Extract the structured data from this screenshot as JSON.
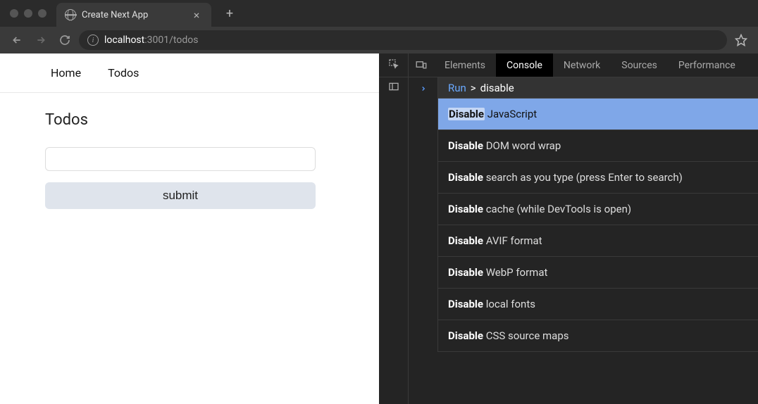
{
  "browser": {
    "tab_title": "Create Next App",
    "url_host": "localhost",
    "url_port": ":3001",
    "url_path": "/todos"
  },
  "page": {
    "nav": {
      "home": "Home",
      "todos": "Todos"
    },
    "heading": "Todos",
    "submit_label": "submit"
  },
  "devtools": {
    "tabs": {
      "elements": "Elements",
      "console": "Console",
      "network": "Network",
      "sources": "Sources",
      "performance": "Performance"
    },
    "command": {
      "run_label": "Run",
      "query": "disable"
    },
    "results": [
      {
        "bold": "Disable",
        "rest": " JavaScript",
        "selected": true
      },
      {
        "bold": "Disable",
        "rest": " DOM word wrap",
        "selected": false
      },
      {
        "bold": "Disable",
        "rest": " search as you type (press Enter to search)",
        "selected": false
      },
      {
        "bold": "Disable",
        "rest": " cache (while DevTools is open)",
        "selected": false
      },
      {
        "bold": "Disable",
        "rest": " AVIF format",
        "selected": false
      },
      {
        "bold": "Disable",
        "rest": " WebP format",
        "selected": false
      },
      {
        "bold": "Disable",
        "rest": " local fonts",
        "selected": false
      },
      {
        "bold": "Disable",
        "rest": " CSS source maps",
        "selected": false
      }
    ]
  }
}
